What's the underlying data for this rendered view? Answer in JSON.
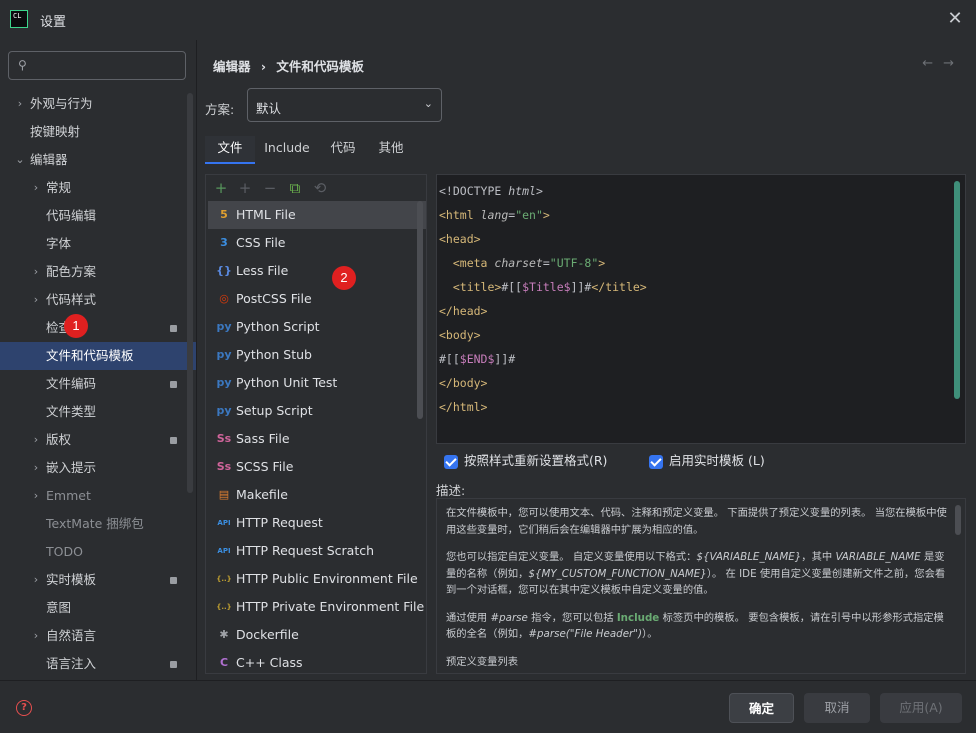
{
  "window": {
    "app_logo": "CL",
    "title": "设置",
    "close_icon": "close-icon"
  },
  "search": {
    "placeholder": "",
    "value": ""
  },
  "tree": [
    {
      "label": "外观与行为",
      "chevron": "›",
      "badge": false
    },
    {
      "label": "按键映射",
      "chevron": "",
      "badge": false
    },
    {
      "label": "编辑器",
      "chevron": "⌄",
      "badge": false
    },
    {
      "label": "常规",
      "chevron": "›",
      "badge": false
    },
    {
      "label": "代码编辑",
      "chevron": "",
      "badge": false
    },
    {
      "label": "字体",
      "chevron": "",
      "badge": false
    },
    {
      "label": "配色方案",
      "chevron": "›",
      "badge": false
    },
    {
      "label": "代码样式",
      "chevron": "›",
      "badge": false
    },
    {
      "label": "检查",
      "chevron": "",
      "badge": true
    },
    {
      "label": "文件和代码模板",
      "chevron": "",
      "badge": false,
      "selected": true
    },
    {
      "label": "文件编码",
      "chevron": "",
      "badge": true
    },
    {
      "label": "文件类型",
      "chevron": "",
      "badge": false
    },
    {
      "label": "版权",
      "chevron": "›",
      "badge": true
    },
    {
      "label": "嵌入提示",
      "chevron": "›",
      "badge": false
    },
    {
      "label": "Emmet",
      "chevron": "›",
      "badge": false,
      "dim": true
    },
    {
      "label": "TextMate 捆绑包",
      "chevron": "",
      "badge": false,
      "dim": true
    },
    {
      "label": "TODO",
      "chevron": "",
      "badge": false,
      "dim": true
    },
    {
      "label": "实时模板",
      "chevron": "›",
      "badge": true
    },
    {
      "label": "意图",
      "chevron": "",
      "badge": false
    },
    {
      "label": "自然语言",
      "chevron": "›",
      "badge": false
    },
    {
      "label": "语言注入",
      "chevron": "",
      "badge": true
    }
  ],
  "markers": {
    "m1": "1",
    "m2": "2"
  },
  "breadcrumb": {
    "part1": "编辑器",
    "sep": "›",
    "part2": "文件和代码模板"
  },
  "nav": {
    "back": "←",
    "forward": "→"
  },
  "scheme": {
    "label": "方案:",
    "value": "默认",
    "dropdown": "⌄"
  },
  "tabs": [
    "文件",
    "Include",
    "代码",
    "其他"
  ],
  "toolbar": {
    "add": "+",
    "add2": "+",
    "remove": "−",
    "copy": "⧉",
    "reset": "⟲"
  },
  "files": [
    {
      "name": "HTML File",
      "icon": "5",
      "color": "#e0a030",
      "selected": true
    },
    {
      "name": "CSS File",
      "icon": "3",
      "color": "#3b8ee0"
    },
    {
      "name": "Less File",
      "icon": "{}",
      "color": "#5a8ae0"
    },
    {
      "name": "PostCSS File",
      "icon": "◎",
      "color": "#dd3a0a"
    },
    {
      "name": "Python Script",
      "icon": "py",
      "color": "#3b78c0"
    },
    {
      "name": "Python Stub",
      "icon": "py",
      "color": "#3b78c0"
    },
    {
      "name": "Python Unit Test",
      "icon": "py",
      "color": "#3b78c0"
    },
    {
      "name": "Setup Script",
      "icon": "py",
      "color": "#3b78c0"
    },
    {
      "name": "Sass File",
      "icon": "Ss",
      "color": "#cf649a"
    },
    {
      "name": "SCSS File",
      "icon": "Ss",
      "color": "#cf649a"
    },
    {
      "name": "Makefile",
      "icon": "▤",
      "color": "#e08030"
    },
    {
      "name": "HTTP Request",
      "icon": "API",
      "color": "#3b8ee0"
    },
    {
      "name": "HTTP Request Scratch",
      "icon": "API",
      "color": "#3b8ee0"
    },
    {
      "name": "HTTP Public Environment File",
      "icon": "{..}",
      "color": "#c0a030"
    },
    {
      "name": "HTTP Private Environment File",
      "icon": "{..}",
      "color": "#c0a030"
    },
    {
      "name": "Dockerfile",
      "icon": "✱",
      "color": "#a0a3a8"
    },
    {
      "name": "C++ Class",
      "icon": "C",
      "color": "#b070d0"
    }
  ],
  "code": {
    "l1a": "<!DOCTYPE ",
    "l1b": "html",
    "l1c": ">",
    "l2a": "<html ",
    "l2b": "lang",
    "l2c": "=",
    "l2d": "\"en\"",
    "l2e": ">",
    "l3": "<head>",
    "l4a": "  <meta ",
    "l4b": "charset",
    "l4c": "=",
    "l4d": "\"UTF-8\"",
    "l4e": ">",
    "l5a": "  <title>",
    "l5b": "#[[",
    "l5c": "$Title$",
    "l5d": "]]#",
    "l5e": "</title>",
    "l6": "</head>",
    "l7": "<body>",
    "l8a": "#[[",
    "l8b": "$END$",
    "l8c": "]]#",
    "l9": "</body>",
    "l10": "</html>"
  },
  "options": {
    "reformat": "按照样式重新设置格式(R)",
    "live_templates": "启用实时模板 (L)"
  },
  "description": {
    "label": "描述:",
    "p1": "在文件模板中，您可以使用文本、代码、注释和预定义变量。 下面提供了预定义变量的列表。 当您在模板中使用这些变量时，它们稍后会在编辑器中扩展为相应的值。",
    "p2a": "您也可以指定自定义变量。 自定义变量使用以下格式：",
    "p2b": "${VARIABLE_NAME}",
    "p2c": "，其中 ",
    "p2d": "VARIABLE_NAME",
    "p2e": " 是变量的名称（例如，",
    "p2f": "${MY_CUSTOM_FUNCTION_NAME}",
    "p2g": "）。 在 IDE 使用自定义变量创建新文件之前，您会看到一个对话框，您可以在其中定义模板中自定义变量的值。",
    "p3a": "通过使用 ",
    "p3b": "#parse",
    "p3c": " 指令，您可以包括 ",
    "p3d": "Include",
    "p3e": " 标签页中的模板。 要包含模板，请在引号中以形参形式指定模板的全名（例如，",
    "p3f": "#parse(\"File Header\")",
    "p3g": "）。",
    "p4": "预定义变量列表"
  },
  "footer": {
    "help": "?",
    "ok": "确定",
    "cancel": "取消",
    "apply": "应用(A)"
  }
}
